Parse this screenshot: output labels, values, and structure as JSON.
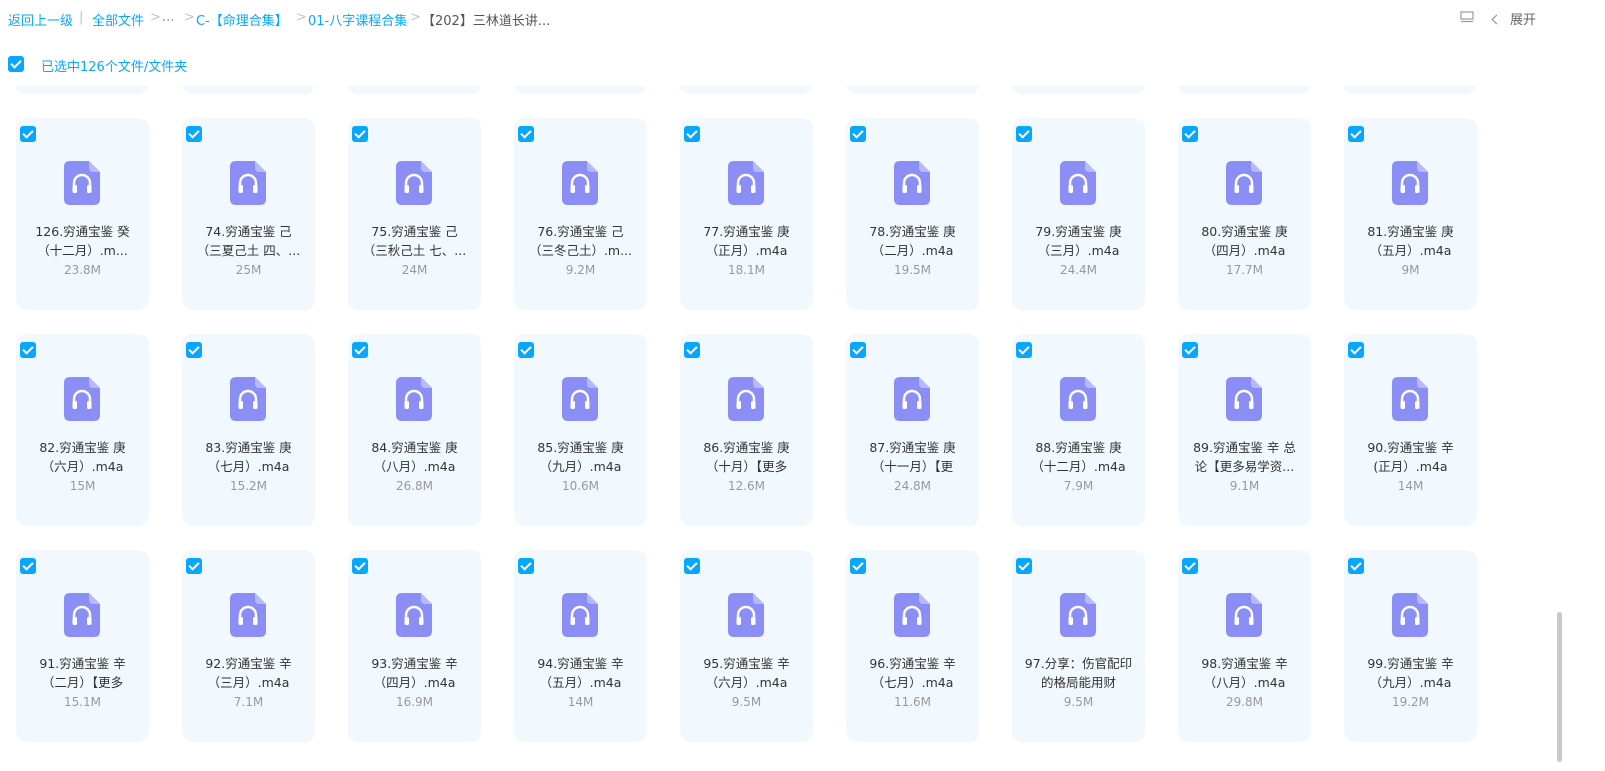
{
  "breadcrumb": {
    "back": "返回上一级",
    "root": "全部文件",
    "ellipsis": "...",
    "level1": "C-【命理合集】",
    "level2": "01-八字课程合集",
    "current": "【202】三林道长讲..."
  },
  "header": {
    "expand_label": "展开"
  },
  "selection": {
    "text": "已选中126个文件/文件夹"
  },
  "colors": {
    "accent": "#06a7ff",
    "icon": "#8b8ef5",
    "card_bg": "#f2f9fe"
  },
  "files": [
    {
      "line1": "126.穷通宝鉴 癸",
      "line2": "（十二月）.m...",
      "size": "23.8M"
    },
    {
      "line1": "74.穷通宝鉴 己",
      "line2": "（三夏己土 四、...",
      "size": "25M"
    },
    {
      "line1": "75.穷通宝鉴 己",
      "line2": "（三秋己土 七、...",
      "size": "24M"
    },
    {
      "line1": "76.穷通宝鉴 己",
      "line2": "（三冬己土）.m...",
      "size": "9.2M"
    },
    {
      "line1": "77.穷通宝鉴 庚",
      "line2": "（正月）.m4a",
      "size": "18.1M"
    },
    {
      "line1": "78.穷通宝鉴 庚",
      "line2": "（二月）.m4a",
      "size": "19.5M"
    },
    {
      "line1": "79.穷通宝鉴 庚",
      "line2": "（三月）.m4a",
      "size": "24.4M"
    },
    {
      "line1": "80.穷通宝鉴 庚",
      "line2": "（四月）.m4a",
      "size": "17.7M"
    },
    {
      "line1": "81.穷通宝鉴 庚",
      "line2": "（五月）.m4a",
      "size": "9M"
    },
    {
      "line1": "82.穷通宝鉴 庚",
      "line2": "（六月）.m4a",
      "size": "15M"
    },
    {
      "line1": "83.穷通宝鉴 庚",
      "line2": "（七月）.m4a",
      "size": "15.2M"
    },
    {
      "line1": "84.穷通宝鉴 庚",
      "line2": "（八月）.m4a",
      "size": "26.8M"
    },
    {
      "line1": "85.穷通宝鉴 庚",
      "line2": "（九月）.m4a",
      "size": "10.6M"
    },
    {
      "line1": "86.穷通宝鉴 庚",
      "line2": "（十月）【更多",
      "size": "12.6M"
    },
    {
      "line1": "87.穷通宝鉴 庚",
      "line2": "（十一月）【更",
      "size": "24.8M"
    },
    {
      "line1": "88.穷通宝鉴 庚",
      "line2": "（十二月）.m4a",
      "size": "7.9M"
    },
    {
      "line1": "89.穷通宝鉴 辛 总",
      "line2": "论【更多易学资...",
      "size": "9.1M"
    },
    {
      "line1": "90.穷通宝鉴 辛",
      "line2": "(正月）.m4a",
      "size": "14M"
    },
    {
      "line1": "91.穷通宝鉴 辛",
      "line2": "（二月）【更多",
      "size": "15.1M"
    },
    {
      "line1": "92.穷通宝鉴 辛",
      "line2": "（三月）.m4a",
      "size": "7.1M"
    },
    {
      "line1": "93.穷通宝鉴 辛",
      "line2": "（四月）.m4a",
      "size": "16.9M"
    },
    {
      "line1": "94.穷通宝鉴 辛",
      "line2": "（五月）.m4a",
      "size": "14M"
    },
    {
      "line1": "95.穷通宝鉴 辛",
      "line2": "（六月）.m4a",
      "size": "9.5M"
    },
    {
      "line1": "96.穷通宝鉴 辛",
      "line2": "（七月）.m4a",
      "size": "11.6M"
    },
    {
      "line1": "97.分享：伤官配印",
      "line2": "的格局能用财",
      "size": "9.5M"
    },
    {
      "line1": "98.穷通宝鉴 辛",
      "line2": "（八月）.m4a",
      "size": "29.8M"
    },
    {
      "line1": "99.穷通宝鉴 辛",
      "line2": "（九月）.m4a",
      "size": "19.2M"
    }
  ]
}
